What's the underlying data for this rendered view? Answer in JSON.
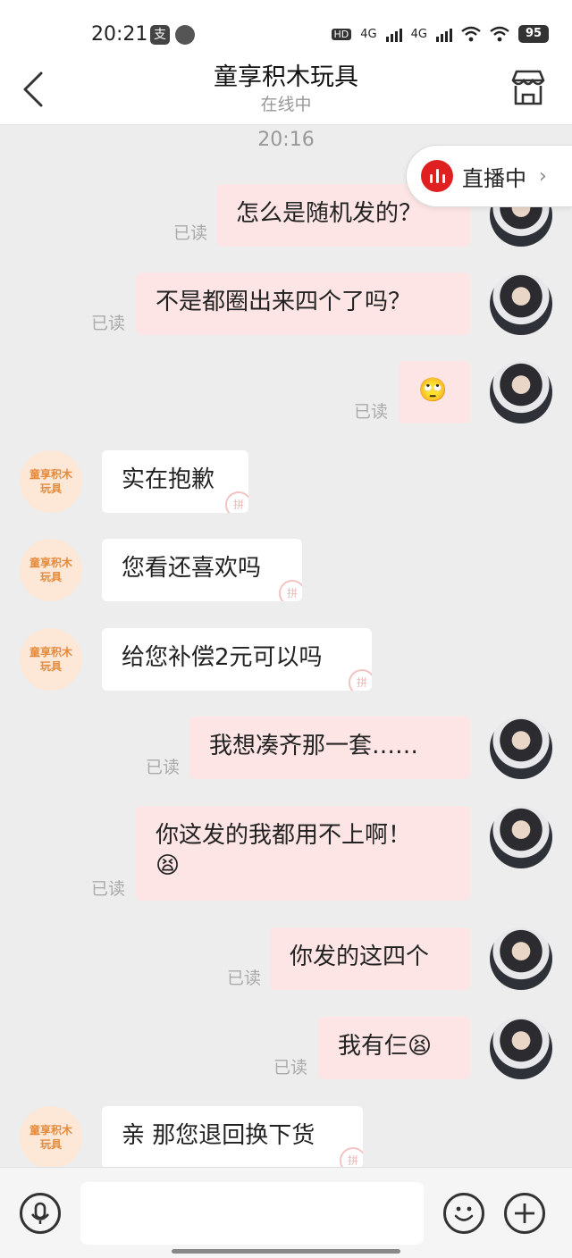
{
  "status_bar": {
    "time": "20:21",
    "pay_icon_text": "支",
    "hd_text": "HD",
    "net1": "4G",
    "net2": "4G",
    "battery": "95"
  },
  "header": {
    "title": "童享积木玩具",
    "subtitle": "在线中"
  },
  "chat": {
    "timestamp": "20:16",
    "live_badge": "直播中",
    "messages": [
      {
        "side": "out",
        "text": "怎么是随机发的？",
        "read": "已读"
      },
      {
        "side": "out",
        "text": "不是都圈出来四个了吗？",
        "read": "已读"
      },
      {
        "side": "out",
        "text": "🙄",
        "read": "已读"
      },
      {
        "side": "in",
        "text": "实在抱歉",
        "avatar": "童享积木玩具"
      },
      {
        "side": "in",
        "text": "您看还喜欢吗",
        "avatar": "童享积木玩具"
      },
      {
        "side": "in",
        "text": "给您补偿2元可以吗",
        "avatar": "童享积木玩具"
      },
      {
        "side": "out",
        "text": "我想凑齐那一套……",
        "read": "已读"
      },
      {
        "side": "out",
        "text": "你这发的我都用不上啊！",
        "text2": "😫",
        "read": "已读"
      },
      {
        "side": "out",
        "text": "你发的这四个",
        "read": "已读"
      },
      {
        "side": "out",
        "text": "我有仨😫",
        "read": "已读"
      },
      {
        "side": "in",
        "text": "亲 那您退回换下货",
        "avatar": "童享积木玩具"
      }
    ],
    "shop_stamp": "拼"
  },
  "input": {
    "placeholder": ""
  }
}
